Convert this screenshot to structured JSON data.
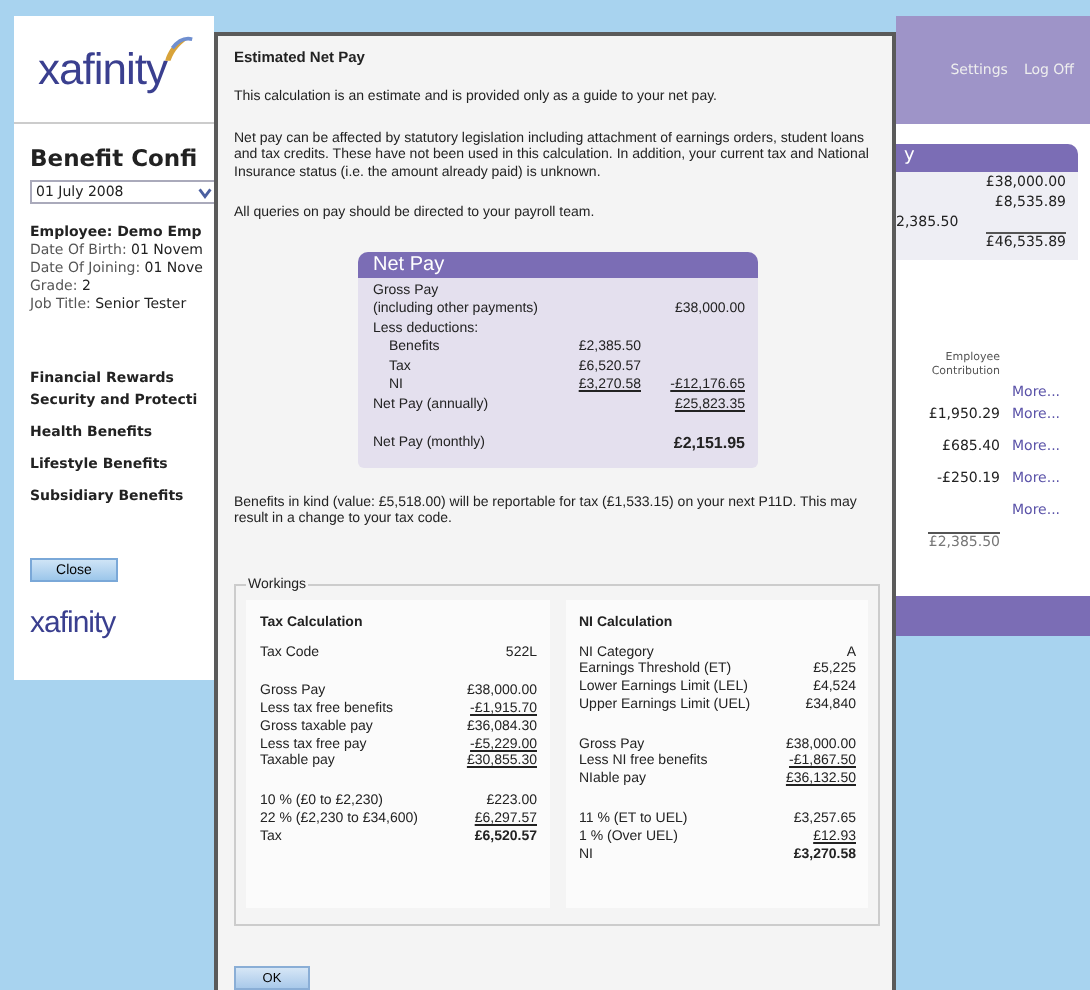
{
  "header": {
    "logo": "xafinity",
    "links": [
      "Settings",
      "Log Off"
    ]
  },
  "left": {
    "title": "Benefit Confi",
    "date_select": "01 July 2008",
    "employee": [
      {
        "label": "Employee:",
        "value": "Demo Emp",
        "bold": true
      },
      {
        "label": "Date Of Birth:",
        "value": "01 Novem",
        "bold": false
      },
      {
        "label": "Date Of Joining:",
        "value": "01 Nove",
        "bold": false
      },
      {
        "label": "Grade:",
        "value": "2",
        "bold": false
      },
      {
        "label": "Job Title:",
        "value": "Senior Tester",
        "bold": false
      }
    ],
    "categories": [
      "Financial Rewards",
      "Security and Protecti",
      "Health Benefits",
      "Lifestyle Benefits",
      "Subsidiary Benefits"
    ],
    "close_button": "Close",
    "footer_logo": "xafinity"
  },
  "summary": {
    "header": "y",
    "rows": [
      {
        "value": "£38,000.00",
        "kind": "plain"
      },
      {
        "value": "£8,535.89",
        "kind": "plain"
      },
      {
        "value": "2,385.50",
        "kind": "cut"
      },
      {
        "value": "£46,535.89",
        "kind": "total"
      }
    ]
  },
  "contributions": {
    "header": "Employee Contribution",
    "rows": [
      {
        "amount": "",
        "link": "More..."
      },
      {
        "amount": "£1,950.29",
        "link": "More..."
      },
      {
        "amount": "£685.40",
        "link": "More..."
      },
      {
        "amount": "-£250.19",
        "link": "More..."
      },
      {
        "amount": "",
        "link": "More..."
      }
    ],
    "total": "£2,385.50"
  },
  "dialog": {
    "title": "Estimated Net Pay",
    "paragraphs": [
      "This calculation is an estimate and is provided only as a guide to your net pay.",
      "Net pay can be affected by statutory legislation including attachment of earnings orders, student loans and tax credits. These have not been used in this calculation. In addition, your current tax and National Insurance status (i.e. the amount already paid) is unknown.",
      "All queries on pay should be directed to your payroll team."
    ],
    "net_pay": {
      "title": "Net Pay",
      "rows": [
        {
          "label": "Gross Pay",
          "kind": "label"
        },
        {
          "label": "(including other payments)",
          "col2": "£38,000.00",
          "kind": "label"
        },
        {
          "label": "Less deductions:",
          "kind": "label"
        },
        {
          "label": "Benefits",
          "col1": "£2,385.50",
          "kind": "item"
        },
        {
          "label": "Tax",
          "col1": "£6,520.57",
          "kind": "item"
        },
        {
          "label": "NI",
          "col1": "£3,270.58",
          "col2": "-£12,176.65",
          "kind": "item_subtotal"
        },
        {
          "label": "Net Pay (annually)",
          "col2": "£25,823.35",
          "kind": "subtotal"
        },
        {
          "label": "Net Pay (monthly)",
          "col2": "£2,151.95",
          "kind": "total"
        }
      ]
    },
    "benefits_note": "Benefits in kind (value: £5,518.00) will be reportable for tax (£1,533.15) on your next P11D. This may result in a change to your tax code.",
    "workings": {
      "legend": "Workings",
      "panels": [
        {
          "title": "Tax Calculation",
          "groups": [
            [
              {
                "label": "Tax Code",
                "value": "522L",
                "kind": "plain"
              }
            ],
            [
              {
                "label": "Gross Pay",
                "value": "£38,000.00",
                "kind": "plain"
              },
              {
                "label": "Less tax free benefits",
                "value": "-£1,915.70",
                "kind": "underline"
              },
              {
                "label": "Gross taxable pay",
                "value": "£36,084.30",
                "kind": "plain"
              },
              {
                "label": "Less tax free pay",
                "value": "-£5,229.00",
                "kind": "underline"
              },
              {
                "label": "Taxable pay",
                "value": "£30,855.30",
                "kind": "underline"
              }
            ],
            [
              {
                "label": "10 % (£0 to £2,230)",
                "value": "£223.00",
                "kind": "plain"
              },
              {
                "label": "22 % (£2,230 to £34,600)",
                "value": "£6,297.57",
                "kind": "underline"
              },
              {
                "label": "Tax",
                "value": "£6,520.57",
                "kind": "bold"
              }
            ]
          ]
        },
        {
          "title": "NI Calculation",
          "groups": [
            [
              {
                "label": "NI Category",
                "value": "A",
                "kind": "plain"
              },
              {
                "label": "Earnings Threshold (ET)",
                "value": "£5,225",
                "kind": "plain"
              },
              {
                "label": "Lower Earnings Limit (LEL)",
                "value": "£4,524",
                "kind": "plain"
              },
              {
                "label": "Upper Earnings Limit (UEL)",
                "value": "£34,840",
                "kind": "plain"
              }
            ],
            [
              {
                "label": "Gross Pay",
                "value": "£38,000.00",
                "kind": "plain"
              },
              {
                "label": "Less NI free benefits",
                "value": "-£1,867.50",
                "kind": "underline"
              },
              {
                "label": "NIable pay",
                "value": "£36,132.50",
                "kind": "underline"
              }
            ],
            [
              {
                "label": "11 % (ET to UEL)",
                "value": "£3,257.65",
                "kind": "plain"
              },
              {
                "label": "1 % (Over UEL)",
                "value": "£12.93",
                "kind": "underline"
              },
              {
                "label": "NI",
                "value": "£3,270.58",
                "kind": "bold"
              }
            ]
          ]
        }
      ]
    },
    "ok_button": "OK"
  }
}
